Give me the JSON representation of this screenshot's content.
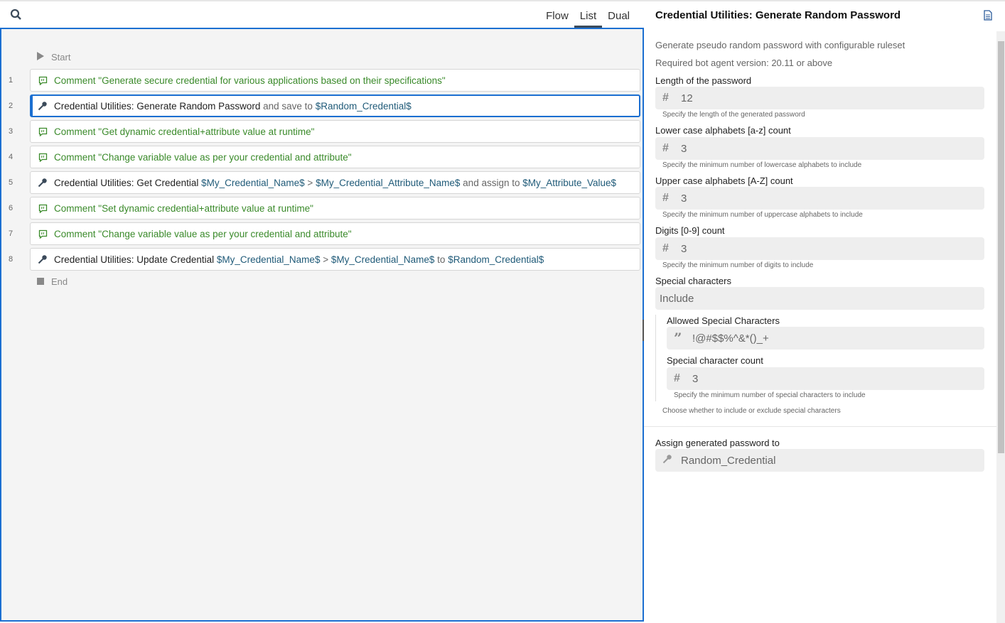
{
  "toolbar": {
    "tabs": [
      "Flow",
      "List",
      "Dual"
    ],
    "active_tab": "List"
  },
  "flow": {
    "start_label": "Start",
    "end_label": "End",
    "rows": [
      {
        "num": "1",
        "type": "comment",
        "parts": [
          {
            "t": "Comment ",
            "s": "comment"
          },
          {
            "t": "\"Generate secure credential for various applications based on their specifications\"",
            "s": "comment"
          }
        ]
      },
      {
        "num": "2",
        "type": "action",
        "selected": true,
        "parts": [
          {
            "t": "Credential Utilities: Generate Random Password",
            "s": "bold"
          },
          {
            "t": " and save to ",
            "s": "light"
          },
          {
            "t": "$Random_Credential$",
            "s": "var"
          }
        ]
      },
      {
        "num": "3",
        "type": "comment",
        "parts": [
          {
            "t": "Comment ",
            "s": "comment"
          },
          {
            "t": "\"Get dynamic credential+attribute value at runtime\"",
            "s": "comment"
          }
        ]
      },
      {
        "num": "4",
        "type": "comment",
        "parts": [
          {
            "t": "Comment ",
            "s": "comment"
          },
          {
            "t": "\"Change variable value as per your credential and attribute\"",
            "s": "comment"
          }
        ]
      },
      {
        "num": "5",
        "type": "action",
        "parts": [
          {
            "t": "Credential Utilities: Get Credential ",
            "s": "bold"
          },
          {
            "t": "$My_Credential_Name$",
            "s": "var"
          },
          {
            "t": " > ",
            "s": "light"
          },
          {
            "t": "$My_Credential_Attribute_Name$",
            "s": "var"
          },
          {
            "t": " and assign to ",
            "s": "light"
          },
          {
            "t": "$My_Attribute_Value$",
            "s": "var"
          }
        ]
      },
      {
        "num": "6",
        "type": "comment",
        "parts": [
          {
            "t": "Comment ",
            "s": "comment"
          },
          {
            "t": "\"Set dynamic credential+attribute value at runtime\"",
            "s": "comment"
          }
        ]
      },
      {
        "num": "7",
        "type": "comment",
        "parts": [
          {
            "t": "Comment ",
            "s": "comment"
          },
          {
            "t": "\"Change variable value as per your credential and attribute\"",
            "s": "comment"
          }
        ]
      },
      {
        "num": "8",
        "type": "action",
        "parts": [
          {
            "t": "Credential Utilities: Update Credential ",
            "s": "bold"
          },
          {
            "t": "$My_Credential_Name$",
            "s": "var"
          },
          {
            "t": " > ",
            "s": "light"
          },
          {
            "t": "$My_Credential_Name$",
            "s": "var"
          },
          {
            "t": " to ",
            "s": "light"
          },
          {
            "t": "$Random_Credential$",
            "s": "var"
          }
        ]
      }
    ]
  },
  "panel": {
    "title": "Credential Utilities: Generate Random Password",
    "description": "Generate pseudo random password with configurable ruleset",
    "version": "Required bot agent version: 20.11 or above",
    "length": {
      "label": "Length of the password",
      "value": "12",
      "help": "Specify the length of the generated password"
    },
    "lower": {
      "label": "Lower case alphabets [a-z] count",
      "value": "3",
      "help": "Specify the minimum number of lowercase alphabets to include"
    },
    "upper": {
      "label": "Upper case alphabets [A-Z] count",
      "value": "3",
      "help": "Specify the minimum number of uppercase alphabets to include"
    },
    "digits": {
      "label": "Digits [0-9] count",
      "value": "3",
      "help": "Specify the minimum number of digits to include"
    },
    "special": {
      "label": "Special characters",
      "value": "Include",
      "help": "Choose whether to include or exclude special characters"
    },
    "allowed": {
      "label": "Allowed Special Characters",
      "value": "!@#$$%^&*()_+"
    },
    "special_count": {
      "label": "Special character count",
      "value": "3",
      "help": "Specify the minimum number of special characters to include"
    },
    "assign": {
      "label": "Assign generated password to",
      "value": "Random_Credential"
    }
  },
  "colors": {
    "accent": "#1b6fd1",
    "comment": "#3a8a2a",
    "variable": "#1f5a78"
  }
}
